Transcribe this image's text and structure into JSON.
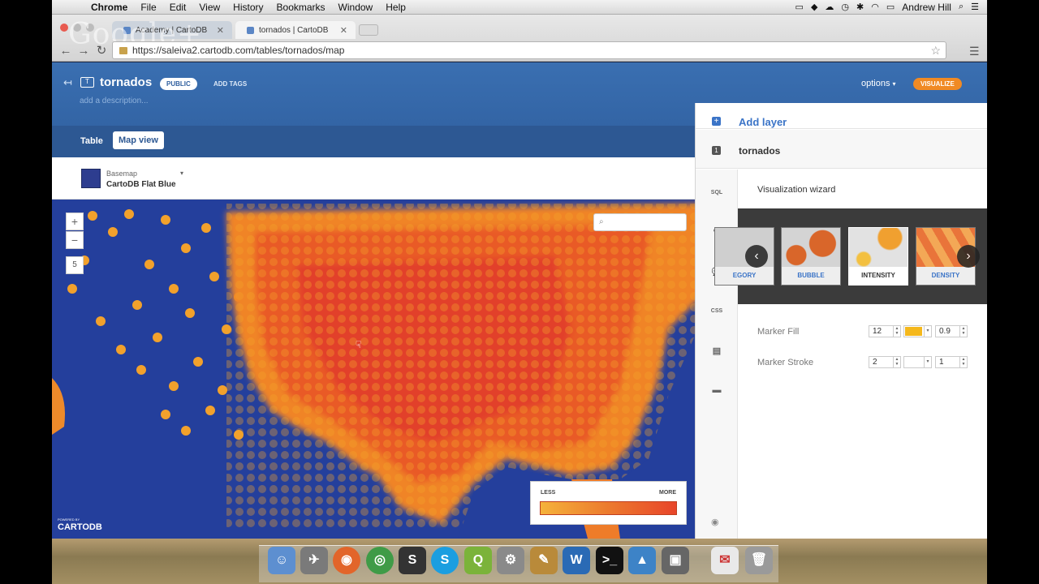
{
  "menubar": {
    "app": "Chrome",
    "items": [
      "File",
      "Edit",
      "View",
      "History",
      "Bookmarks",
      "Window",
      "Help"
    ],
    "user": "Andrew Hill"
  },
  "browser": {
    "watermark": "Google+",
    "tabs": [
      {
        "label": "Academy | CartoDB"
      },
      {
        "label": "tornados | CartoDB"
      }
    ],
    "url": "https://saleiva2.cartodb.com/tables/tornados/map"
  },
  "header": {
    "title": "tornados",
    "privacy": "PUBLIC",
    "add_tags": "ADD TAGS",
    "description_placeholder": "add a description...",
    "options": "options",
    "visualize": "VISUALIZE",
    "tabs": [
      "Table",
      "Map view"
    ]
  },
  "basemap": {
    "label": "Basemap",
    "name": "CartoDB Flat Blue"
  },
  "map": {
    "zoom_in": "+",
    "zoom_out": "−",
    "zoom_level": "5",
    "legend_less": "LESS",
    "legend_more": "MORE",
    "powered": "POWERED BY",
    "brand": "CARTODB"
  },
  "panel": {
    "add_layer": "Add layer",
    "layer_number": "1",
    "layer_name": "tornados",
    "sidebar": [
      "SQL",
      "✎",
      "💬",
      "CSS",
      "▤",
      "▬"
    ],
    "wizard_title": "Visualization wizard",
    "wizards": [
      {
        "label": "EGORY"
      },
      {
        "label": "BUBBLE"
      },
      {
        "label": "INTENSITY",
        "selected": true
      },
      {
        "label": "DENSITY"
      }
    ],
    "marker_fill": {
      "label": "Marker Fill",
      "width": "12",
      "color": "#f5b81c",
      "opacity": "0.9"
    },
    "marker_stroke": {
      "label": "Marker Stroke",
      "width": "2",
      "color": "#ffffff",
      "opacity": "1"
    }
  },
  "colors": {
    "header_blue": "#3a6fb1",
    "visualize_orange": "#f08a24",
    "map_blue": "#243f9c",
    "heat_red": "#e8452a"
  }
}
